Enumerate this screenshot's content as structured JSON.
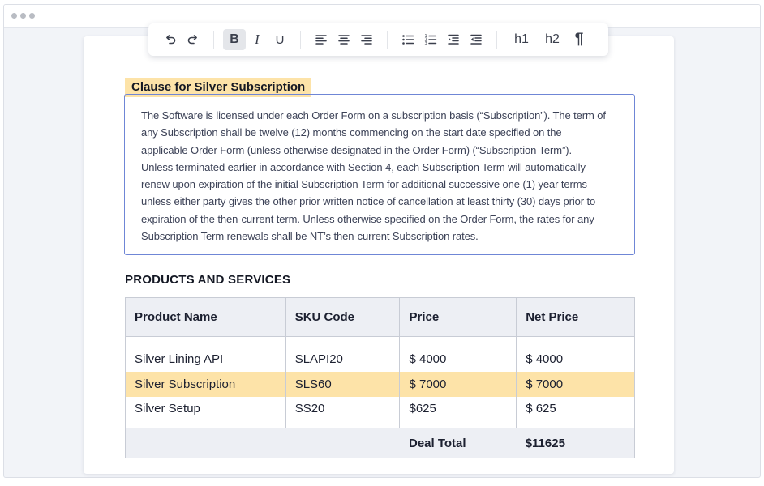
{
  "toolbar": {
    "undo_icon": "undo-icon",
    "redo_icon": "redo-icon",
    "bold_label": "B",
    "italic_label": "I",
    "underline_label": "U",
    "align_left_icon": "align-left-icon",
    "align_center_icon": "align-center-icon",
    "align_right_icon": "align-right-icon",
    "bullet_list_icon": "bullet-list-icon",
    "numbered_list_icon": "numbered-list-icon",
    "indent_icon": "indent-icon",
    "outdent_icon": "outdent-icon",
    "h1_label": "h1",
    "h2_label": "h2",
    "paragraph_label": "¶",
    "active_button": "bold"
  },
  "clause": {
    "title": "Clause for Silver Subscription",
    "lines": [
      "The Software is licensed under each Order Form on a subscription basis (“Subscription”). The term of",
      "any Subscription shall be twelve (12) months commencing on the start date specified on the",
      "applicable Order Form (unless otherwise designated in the Order Form) (“Subscription Term”).",
      "Unless terminated earlier in accordance with Section 4, each Subscription Term will automatically",
      "renew upon expiration of the initial Subscription Term for additional successive one (1) year terms",
      "unless either party gives the other prior written notice of cancellation at least thirty (30) days prior to",
      "expiration of the then-current term. Unless otherwise specified on the Order Form, the rates for any",
      "Subscription Term renewals shall be NT’s then-current Subscription rates."
    ]
  },
  "products": {
    "heading": "PRODUCTS AND SERVICES",
    "columns": [
      "Product Name",
      "SKU Code",
      "Price",
      "Net Price"
    ],
    "rows": [
      [
        "Silver Lining API",
        "SLAPI20",
        "$ 4000",
        "$ 4000"
      ],
      [
        "Silver Subscription",
        "SLS60",
        "$ 7000",
        "$ 7000"
      ],
      [
        "Silver Setup",
        "SS20",
        "$625",
        "$ 625"
      ]
    ],
    "highlighted_row": 1,
    "total_label": "Deal Total",
    "total_value": "$11625"
  },
  "colors": {
    "highlight": "#fde3a8",
    "clause_border": "#6f86d6",
    "table_header_bg": "#edeff4"
  }
}
